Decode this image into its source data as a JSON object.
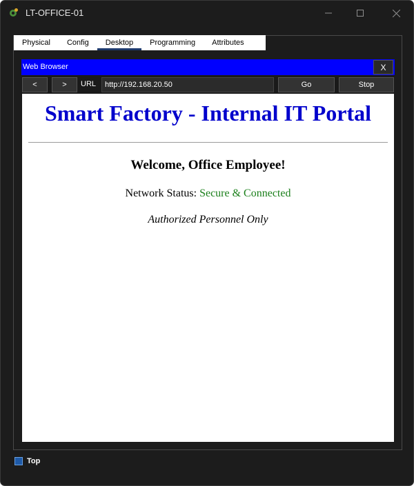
{
  "window": {
    "title": "LT-OFFICE-01",
    "controls": [
      "minimize-icon",
      "maximize-icon",
      "close-icon"
    ]
  },
  "tabs": [
    {
      "label": "Physical",
      "active": false
    },
    {
      "label": "Config",
      "active": false
    },
    {
      "label": "Desktop",
      "active": true
    },
    {
      "label": "Programming",
      "active": false
    },
    {
      "label": "Attributes",
      "active": false
    }
  ],
  "browser": {
    "title": "Web Browser",
    "close_label": "X",
    "back_label": "<",
    "forward_label": ">",
    "url_label": "URL",
    "url_value": "http://192.168.20.50",
    "go_label": "Go",
    "stop_label": "Stop",
    "title_bar_color": "#0000ff"
  },
  "page": {
    "heading": "Smart Factory - Internal IT Portal",
    "welcome": "Welcome, Office Employee!",
    "status_label": "Network Status: ",
    "status_value": "Secure & Connected",
    "notice": "Authorized Personnel Only",
    "heading_color": "#0000cc",
    "status_color": "#1a7f1a"
  },
  "footer": {
    "top_label": "Top",
    "top_checked": true
  }
}
